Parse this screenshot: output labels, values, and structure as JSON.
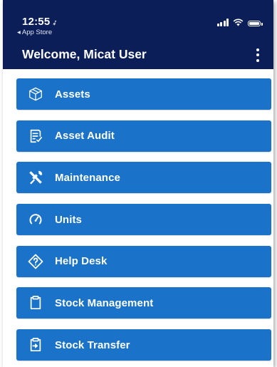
{
  "status_bar": {
    "time": "12:55",
    "location_glyph": "➶",
    "back_app": "◂ App Store"
  },
  "header": {
    "title": "Welcome, Micat User"
  },
  "menu": {
    "items": [
      {
        "label": "Assets",
        "icon": "cube-icon"
      },
      {
        "label": "Asset Audit",
        "icon": "checklist-icon"
      },
      {
        "label": "Maintenance",
        "icon": "tools-icon"
      },
      {
        "label": "Units",
        "icon": "gauge-icon"
      },
      {
        "label": "Help Desk",
        "icon": "help-diamond-icon"
      },
      {
        "label": "Stock Management",
        "icon": "clipboard-icon"
      },
      {
        "label": "Stock Transfer",
        "icon": "transfer-icon"
      }
    ]
  },
  "colors": {
    "header_bg": "#0c1e57",
    "item_bg": "#1a73c9",
    "text": "#ffffff"
  }
}
